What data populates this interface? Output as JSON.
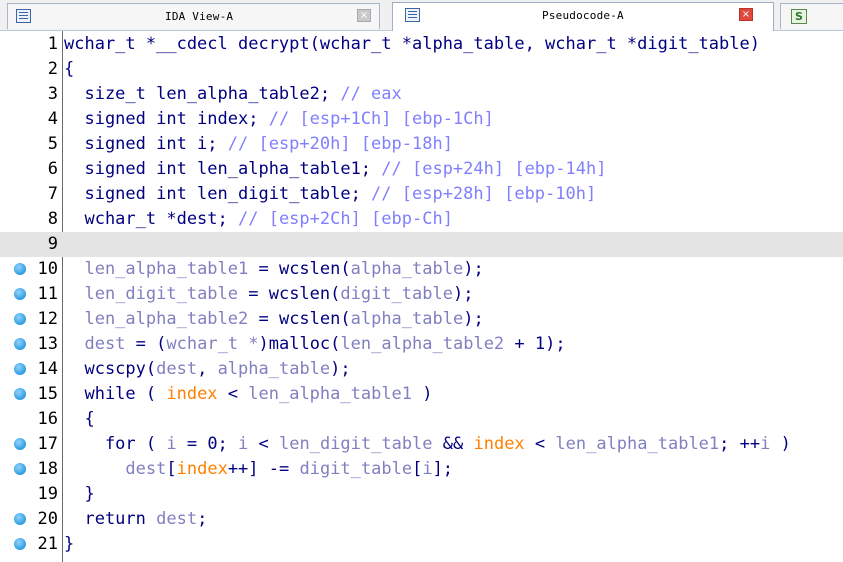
{
  "tabs": [
    {
      "title": "IDA View-A",
      "active": false
    },
    {
      "title": "Pseudocode-A",
      "active": true
    },
    {
      "title": "",
      "active": false
    }
  ],
  "close_glyph": "×",
  "strings_icon_glyph": "S",
  "icons": {
    "ida_view": "disassembly-view-icon",
    "pseudocode": "pseudocode-view-icon",
    "strings": "strings-view-icon",
    "close": "close-icon",
    "breakpoint": "breakpoint-dot-icon"
  },
  "colors": {
    "keyword": "#000080",
    "comment": "#7f7fff",
    "variable": "#8080c0",
    "local_highlight": "#ff8000",
    "current_line": "#e4e4e4",
    "breakpoint": "#2f9be0"
  },
  "lines": [
    {
      "num": "1",
      "bp": false,
      "segments": [
        {
          "t": "p",
          "s": "wchar_t *__cdecl decrypt(wchar_t *alpha_table, wchar_t *digit_table)"
        }
      ]
    },
    {
      "num": "2",
      "bp": false,
      "segments": [
        {
          "t": "p",
          "s": "{"
        }
      ]
    },
    {
      "num": "3",
      "bp": false,
      "segments": [
        {
          "t": "p",
          "s": "  size_t len_alpha_table2; "
        },
        {
          "t": "c",
          "s": "// eax"
        }
      ]
    },
    {
      "num": "4",
      "bp": false,
      "segments": [
        {
          "t": "p",
          "s": "  signed int index; "
        },
        {
          "t": "c",
          "s": "// [esp+1Ch] [ebp-1Ch]"
        }
      ]
    },
    {
      "num": "5",
      "bp": false,
      "segments": [
        {
          "t": "p",
          "s": "  signed int i; "
        },
        {
          "t": "c",
          "s": "// [esp+20h] [ebp-18h]"
        }
      ]
    },
    {
      "num": "6",
      "bp": false,
      "segments": [
        {
          "t": "p",
          "s": "  signed int len_alpha_table1; "
        },
        {
          "t": "c",
          "s": "// [esp+24h] [ebp-14h]"
        }
      ]
    },
    {
      "num": "7",
      "bp": false,
      "segments": [
        {
          "t": "p",
          "s": "  signed int len_digit_table; "
        },
        {
          "t": "c",
          "s": "// [esp+28h] [ebp-10h]"
        }
      ]
    },
    {
      "num": "8",
      "bp": false,
      "segments": [
        {
          "t": "p",
          "s": "  wchar_t *dest; "
        },
        {
          "t": "c",
          "s": "// [esp+2Ch] [ebp-Ch]"
        }
      ]
    },
    {
      "num": "9",
      "bp": false,
      "highlight": true,
      "segments": []
    },
    {
      "num": "10",
      "bp": true,
      "segments": [
        {
          "t": "p",
          "s": "  "
        },
        {
          "t": "v",
          "s": "len_alpha_table1"
        },
        {
          "t": "p",
          "s": " = wcslen("
        },
        {
          "t": "v",
          "s": "alpha_table"
        },
        {
          "t": "p",
          "s": ");"
        }
      ]
    },
    {
      "num": "11",
      "bp": true,
      "segments": [
        {
          "t": "p",
          "s": "  "
        },
        {
          "t": "v",
          "s": "len_digit_table"
        },
        {
          "t": "p",
          "s": " = wcslen("
        },
        {
          "t": "v",
          "s": "digit_table"
        },
        {
          "t": "p",
          "s": ");"
        }
      ]
    },
    {
      "num": "12",
      "bp": true,
      "segments": [
        {
          "t": "p",
          "s": "  "
        },
        {
          "t": "v",
          "s": "len_alpha_table2"
        },
        {
          "t": "p",
          "s": " = wcslen("
        },
        {
          "t": "v",
          "s": "alpha_table"
        },
        {
          "t": "p",
          "s": ");"
        }
      ]
    },
    {
      "num": "13",
      "bp": true,
      "segments": [
        {
          "t": "p",
          "s": "  "
        },
        {
          "t": "v",
          "s": "dest"
        },
        {
          "t": "p",
          "s": " = ("
        },
        {
          "t": "v",
          "s": "wchar_t *"
        },
        {
          "t": "p",
          "s": ")malloc("
        },
        {
          "t": "v",
          "s": "len_alpha_table2"
        },
        {
          "t": "p",
          "s": " + 1);"
        }
      ]
    },
    {
      "num": "14",
      "bp": true,
      "segments": [
        {
          "t": "p",
          "s": "  wcscpy("
        },
        {
          "t": "v",
          "s": "dest"
        },
        {
          "t": "p",
          "s": ", "
        },
        {
          "t": "v",
          "s": "alpha_table"
        },
        {
          "t": "p",
          "s": ");"
        }
      ]
    },
    {
      "num": "15",
      "bp": true,
      "segments": [
        {
          "t": "p",
          "s": "  while ( "
        },
        {
          "t": "o",
          "s": "index"
        },
        {
          "t": "p",
          "s": " < "
        },
        {
          "t": "v",
          "s": "len_alpha_table1"
        },
        {
          "t": "p",
          "s": " )"
        }
      ]
    },
    {
      "num": "16",
      "bp": false,
      "segments": [
        {
          "t": "p",
          "s": "  {"
        }
      ]
    },
    {
      "num": "17",
      "bp": true,
      "segments": [
        {
          "t": "p",
          "s": "    for ( "
        },
        {
          "t": "v",
          "s": "i"
        },
        {
          "t": "p",
          "s": " = 0; "
        },
        {
          "t": "v",
          "s": "i"
        },
        {
          "t": "p",
          "s": " < "
        },
        {
          "t": "v",
          "s": "len_digit_table"
        },
        {
          "t": "p",
          "s": " && "
        },
        {
          "t": "o",
          "s": "index"
        },
        {
          "t": "p",
          "s": " < "
        },
        {
          "t": "v",
          "s": "len_alpha_table1"
        },
        {
          "t": "p",
          "s": "; ++"
        },
        {
          "t": "v",
          "s": "i"
        },
        {
          "t": "p",
          "s": " )"
        }
      ]
    },
    {
      "num": "18",
      "bp": true,
      "segments": [
        {
          "t": "p",
          "s": "      "
        },
        {
          "t": "v",
          "s": "dest"
        },
        {
          "t": "p",
          "s": "["
        },
        {
          "t": "o",
          "s": "index"
        },
        {
          "t": "p",
          "s": "++] -= "
        },
        {
          "t": "v",
          "s": "digit_table"
        },
        {
          "t": "p",
          "s": "["
        },
        {
          "t": "v",
          "s": "i"
        },
        {
          "t": "p",
          "s": "];"
        }
      ]
    },
    {
      "num": "19",
      "bp": false,
      "segments": [
        {
          "t": "p",
          "s": "  }"
        }
      ]
    },
    {
      "num": "20",
      "bp": true,
      "segments": [
        {
          "t": "p",
          "s": "  return "
        },
        {
          "t": "v",
          "s": "dest"
        },
        {
          "t": "p",
          "s": ";"
        }
      ]
    },
    {
      "num": "21",
      "bp": true,
      "segments": [
        {
          "t": "p",
          "s": "}"
        }
      ]
    }
  ]
}
